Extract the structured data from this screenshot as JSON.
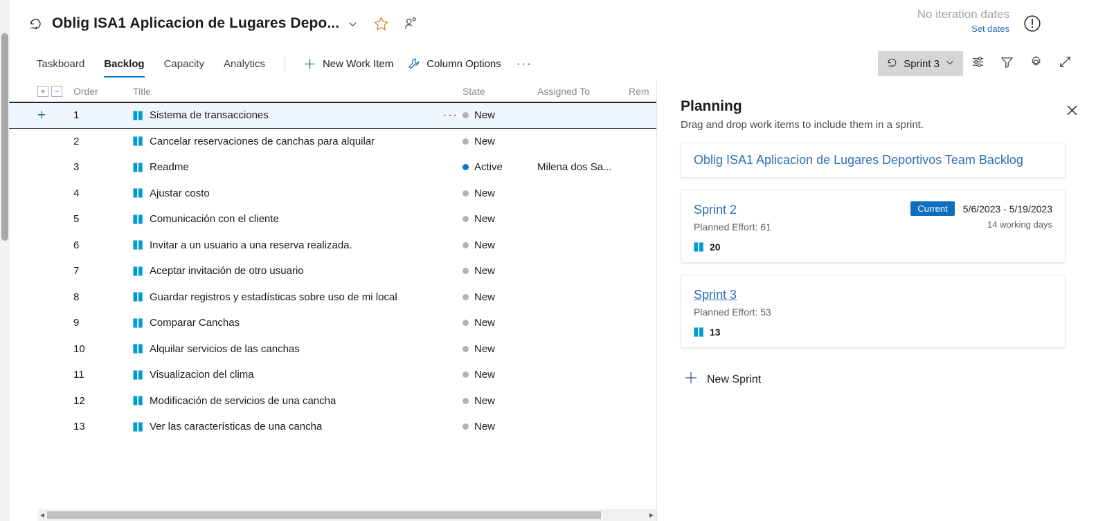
{
  "header": {
    "title": "Oblig ISA1 Aplicacion de Lugares Depo...",
    "chevron_icon": "chevron-down-icon",
    "favorite_icon": "star-icon",
    "follow_icon": "follow-person-icon",
    "sprint_icon": "sprint-icon"
  },
  "iteration": {
    "no_dates": "No iteration dates",
    "set_dates": "Set dates",
    "warning_icon": "warning-circle-icon"
  },
  "pivots": [
    {
      "label": "Taskboard",
      "selected": false
    },
    {
      "label": "Backlog",
      "selected": true
    },
    {
      "label": "Capacity",
      "selected": false
    },
    {
      "label": "Analytics",
      "selected": false
    }
  ],
  "commands": {
    "new_work_item": "New Work Item",
    "new_work_item_icon": "plus-icon",
    "column_options": "Column Options",
    "column_options_icon": "wrench-icon",
    "overflow": "···"
  },
  "toolbar_right": {
    "sprint_picker": "Sprint 3",
    "sprint_picker_icon": "sprint-icon",
    "sprint_picker_chevron": "chevron-down-icon",
    "view_options_icon": "sliders-icon",
    "filter_icon": "funnel-icon",
    "settings_icon": "gear-icon",
    "fullscreen_icon": "expand-arrows-icon"
  },
  "grid": {
    "expand_all_icon": "plus-square-icon",
    "collapse_all_icon": "minus-square-icon",
    "columns": [
      "Order",
      "Title",
      "State",
      "Assigned To",
      "Rem"
    ],
    "rows": [
      {
        "order": "1",
        "title": "Sistema de transacciones",
        "state": "New",
        "assigned": "",
        "selected": true,
        "state_active": false
      },
      {
        "order": "2",
        "title": "Cancelar reservaciones de canchas para alquilar",
        "state": "New",
        "assigned": "",
        "selected": false,
        "state_active": false
      },
      {
        "order": "3",
        "title": "Readme",
        "state": "Active",
        "assigned": "Milena dos Sa...",
        "selected": false,
        "state_active": true
      },
      {
        "order": "4",
        "title": "Ajustar costo",
        "state": "New",
        "assigned": "",
        "selected": false,
        "state_active": false
      },
      {
        "order": "5",
        "title": "Comunicación con el cliente",
        "state": "New",
        "assigned": "",
        "selected": false,
        "state_active": false
      },
      {
        "order": "6",
        "title": "Invitar a un usuario a una reserva realizada.",
        "state": "New",
        "assigned": "",
        "selected": false,
        "state_active": false
      },
      {
        "order": "7",
        "title": "Aceptar invitación de otro usuario",
        "state": "New",
        "assigned": "",
        "selected": false,
        "state_active": false
      },
      {
        "order": "8",
        "title": "Guardar registros y estadísticas sobre uso de mi local",
        "state": "New",
        "assigned": "",
        "selected": false,
        "state_active": false
      },
      {
        "order": "9",
        "title": "Comparar Canchas",
        "state": "New",
        "assigned": "",
        "selected": false,
        "state_active": false
      },
      {
        "order": "10",
        "title": "Alquilar servicios de las canchas",
        "state": "New",
        "assigned": "",
        "selected": false,
        "state_active": false
      },
      {
        "order": "11",
        "title": "Visualizacion del clima",
        "state": "New",
        "assigned": "",
        "selected": false,
        "state_active": false
      },
      {
        "order": "12",
        "title": "Modificación de servicios de una cancha",
        "state": "New",
        "assigned": "",
        "selected": false,
        "state_active": false
      },
      {
        "order": "13",
        "title": "Ver las características de una cancha",
        "state": "New",
        "assigned": "",
        "selected": false,
        "state_active": false
      }
    ]
  },
  "planning": {
    "title": "Planning",
    "subtitle": "Drag and drop work items to include them in a sprint.",
    "close_icon": "close-icon",
    "team_backlog": "Oblig ISA1 Aplicacion de Lugares Deportivos Team Backlog",
    "sprints": [
      {
        "name": "Sprint 2",
        "planned_effort": "Planned Effort: 61",
        "badge": "Current",
        "dates": "5/6/2023 - 5/19/2023",
        "working_days": "14 working days",
        "count": "20",
        "underline": false
      },
      {
        "name": "Sprint 3",
        "planned_effort": "Planned Effort: 53",
        "badge": "",
        "dates": "",
        "working_days": "",
        "count": "13",
        "underline": true
      }
    ],
    "new_sprint": "New Sprint",
    "new_sprint_icon": "plus-icon"
  },
  "colors": {
    "accent": "#0078d4",
    "link": "#2b6fb5",
    "badge": "#0b6ebe",
    "state_new": "#b2b2b2",
    "state_active": "#007acc",
    "selected_row_bg": "#eff6fc",
    "warning": "#d9832b",
    "star": "#d9832b"
  }
}
